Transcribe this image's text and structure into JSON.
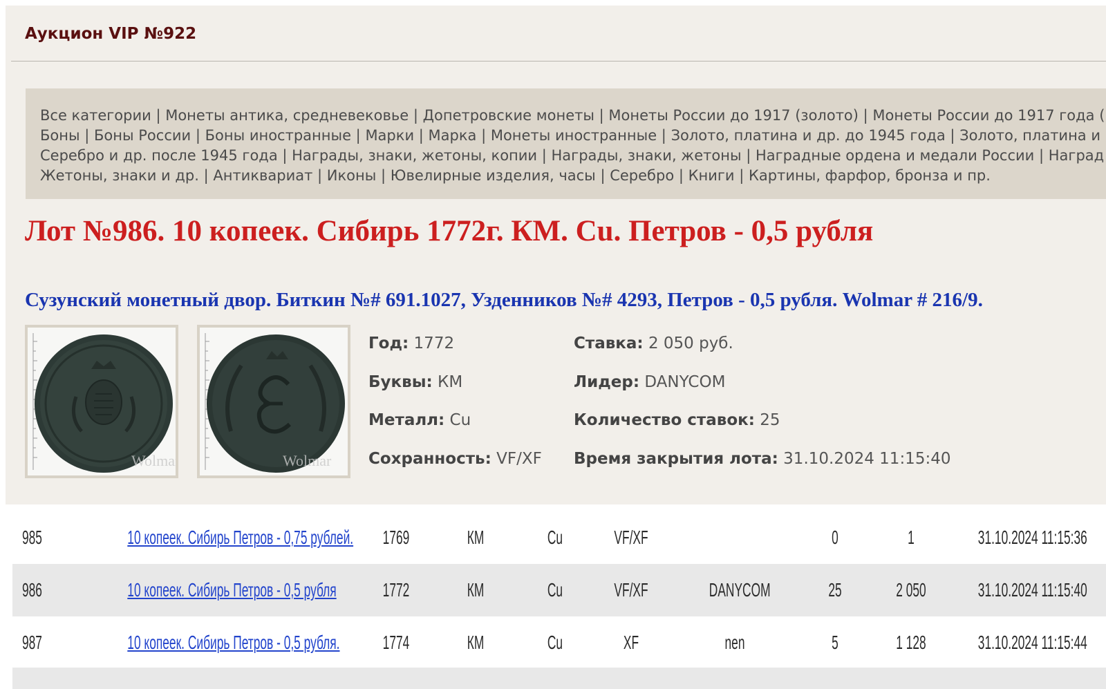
{
  "header": {
    "auction_title": "Аукцион VIP №922"
  },
  "categories": [
    [
      "Все категории",
      "Монеты антика, средневековье",
      "Допетровские монеты",
      "Монеты России до 1917 (золото)",
      "Монеты России до 1917 года ("
    ],
    [
      "Боны",
      "Боны России",
      "Боны иностранные",
      "Марки",
      "Марка",
      "Монеты иностранные",
      "Золото, платина и др. до 1945 года",
      "Золото, платина и"
    ],
    [
      "Серебро и др. после 1945 года",
      "Награды, знаки, жетоны, копии",
      "Награды, знаки, жетоны",
      "Наградные ордена и медали России",
      "Наград"
    ],
    [
      "Жетоны, знаки и др.",
      "Антиквариат",
      "Иконы",
      "Ювелирные изделия, часы",
      "Серебро",
      "Книги",
      "Картины, фарфор, бронза и пр."
    ]
  ],
  "lot": {
    "title": "Лот №986.  10 копеек. Сибирь 1772г. КМ. Cu. Петров - 0,5 рубля",
    "description": "Сузунский монетный двор. Биткин №# 691.1027, Узденников №# 4293, Петров - 0,5 рубля. Wolmar # 216/9.",
    "images": [
      {
        "name": "obverse",
        "watermark": "Wolmar"
      },
      {
        "name": "reverse",
        "watermark": "Wolmar"
      }
    ],
    "year_label": "Год:",
    "year": "1772",
    "letters_label": "Буквы:",
    "letters": "КМ",
    "metal_label": "Металл:",
    "metal": "Cu",
    "grade_label": "Сохранность:",
    "grade": "VF/XF",
    "bid_label": "Ставка:",
    "bid": "2 050 руб.",
    "leader_label": "Лидер:",
    "leader": "DANYCOM",
    "bids_count_label": "Количество ставок:",
    "bids_count": "25",
    "close_label": "Время закрытия лота:",
    "close_time": "31.10.2024 11:15:40"
  },
  "lots_table": [
    {
      "num": "985",
      "name": "10 копеек. Сибирь Петров - 0,75 рублей.",
      "year": "1769",
      "letters": "КМ",
      "metal": "Cu",
      "grade": "VF/XF",
      "leader": "",
      "bids": "0",
      "price": "1",
      "close": "31.10.2024 11:15:36"
    },
    {
      "num": "986",
      "name": "10 копеек. Сибирь Петров - 0,5 рубля",
      "year": "1772",
      "letters": "КМ",
      "metal": "Cu",
      "grade": "VF/XF",
      "leader": "DANYCOM",
      "bids": "25",
      "price": "2 050",
      "close": "31.10.2024 11:15:40"
    },
    {
      "num": "987",
      "name": "10 копеек. Сибирь Петров - 0,5 рубля.",
      "year": "1774",
      "letters": "КМ",
      "metal": "Cu",
      "grade": "XF",
      "leader": "nen",
      "bids": "5",
      "price": "1 128",
      "close": "31.10.2024 11:15:44"
    }
  ],
  "colors": {
    "page_bg": "#f2efea",
    "categories_bg": "#dcd6cb",
    "lot_title": "#cc1f1f",
    "lot_desc": "#1a35b0",
    "link": "#2244cc",
    "row_alt": "#e8e8e8"
  }
}
